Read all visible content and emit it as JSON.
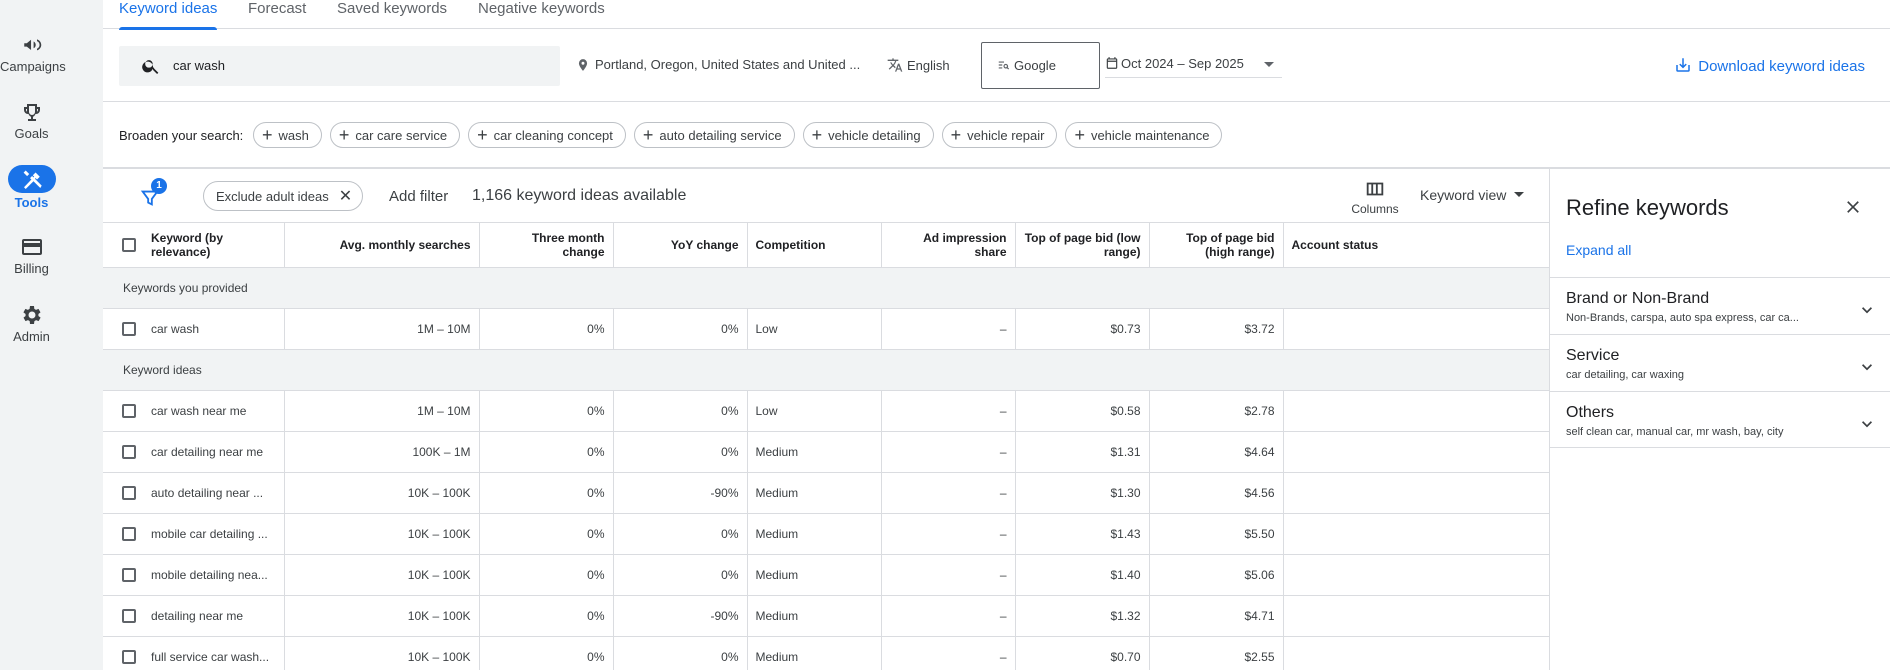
{
  "nav": [
    {
      "label": "Campaigns",
      "icon": "megaphone-icon"
    },
    {
      "label": "Goals",
      "icon": "trophy-icon"
    },
    {
      "label": "Tools",
      "icon": "tools-icon",
      "active": true
    },
    {
      "label": "Billing",
      "icon": "credit-card-icon"
    },
    {
      "label": "Admin",
      "icon": "gear-icon"
    }
  ],
  "tabs": [
    "Keyword ideas",
    "Forecast",
    "Saved keywords",
    "Negative keywords"
  ],
  "search": {
    "query": "car wash",
    "location": "Portland, Oregon, United States and United ...",
    "language": "English",
    "network": "Google",
    "date_range": "Oct 2024 – Sep 2025",
    "download_label": "Download keyword ideas"
  },
  "broaden": {
    "label": "Broaden your search:",
    "chips": [
      "wash",
      "car care service",
      "car cleaning concept",
      "auto detailing service",
      "vehicle detailing",
      "vehicle repair",
      "vehicle maintenance"
    ]
  },
  "toolbar": {
    "filter_badge": "1",
    "exclude_chip": "Exclude adult ideas",
    "add_filter": "Add filter",
    "count": "1,166 keyword ideas available",
    "columns": "Columns",
    "keyword_view": "Keyword view"
  },
  "table": {
    "headers": [
      "Keyword (by relevance)",
      "Avg. monthly searches",
      "Three month change",
      "YoY change",
      "Competition",
      "Ad impression share",
      "Top of page bid (low range)",
      "Top of page bid (high range)",
      "Account status"
    ],
    "group_provided": "Keywords you provided",
    "group_ideas": "Keyword ideas",
    "provided": [
      [
        "car wash",
        "1M – 10M",
        "0%",
        "0%",
        "Low",
        "–",
        "$0.73",
        "$3.72",
        ""
      ]
    ],
    "ideas": [
      [
        "car wash near me",
        "1M – 10M",
        "0%",
        "0%",
        "Low",
        "–",
        "$0.58",
        "$2.78",
        ""
      ],
      [
        "car detailing near me",
        "100K – 1M",
        "0%",
        "0%",
        "Medium",
        "–",
        "$1.31",
        "$4.64",
        ""
      ],
      [
        "auto detailing near ...",
        "10K – 100K",
        "0%",
        "-90%",
        "Medium",
        "–",
        "$1.30",
        "$4.56",
        ""
      ],
      [
        "mobile car detailing ...",
        "10K – 100K",
        "0%",
        "0%",
        "Medium",
        "–",
        "$1.43",
        "$5.50",
        ""
      ],
      [
        "mobile detailing nea...",
        "10K – 100K",
        "0%",
        "0%",
        "Medium",
        "–",
        "$1.40",
        "$5.06",
        ""
      ],
      [
        "detailing near me",
        "10K – 100K",
        "0%",
        "-90%",
        "Medium",
        "–",
        "$1.32",
        "$4.71",
        ""
      ],
      [
        "full service car wash...",
        "10K – 100K",
        "0%",
        "0%",
        "Medium",
        "–",
        "$0.70",
        "$2.55",
        ""
      ]
    ]
  },
  "refine": {
    "title": "Refine keywords",
    "expand_all": "Expand all",
    "sections": [
      {
        "title": "Brand or Non-Brand",
        "subtitle": "Non-Brands, carspa, auto spa express, car ca..."
      },
      {
        "title": "Service",
        "subtitle": "car detailing, car waxing"
      },
      {
        "title": "Others",
        "subtitle": "self clean car, manual car, mr wash, bay, city"
      }
    ]
  }
}
